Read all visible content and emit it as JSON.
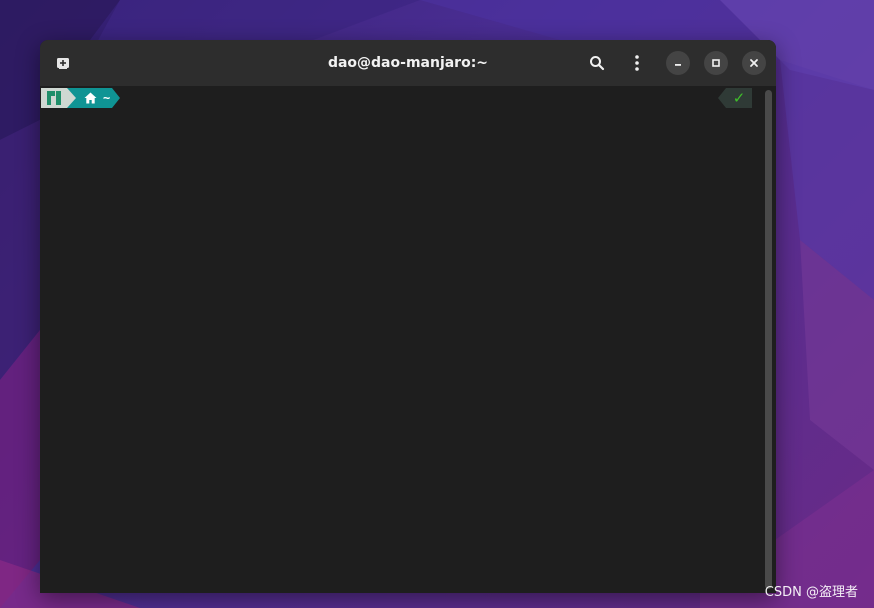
{
  "window": {
    "title": "dao@dao-manjaro:~"
  },
  "titlebar": {
    "icons": {
      "new_tab": "new-tab-icon",
      "search": "search-icon",
      "menu": "kebab-menu-icon",
      "minimize": "minimize-icon",
      "maximize": "maximize-icon",
      "close": "close-icon"
    }
  },
  "terminal": {
    "prompt": {
      "os_icon": "manjaro-logo-icon",
      "home_icon": "home-icon",
      "directory": "~",
      "status_symbol": "✓"
    }
  },
  "watermark": {
    "text": "CSDN @盗理者"
  },
  "colors": {
    "titlebar_bg": "#2d2d2d",
    "terminal_bg": "#1e1e1e",
    "prompt_os_bg": "#cfd8d2",
    "prompt_dir_bg": "#0f9494",
    "prompt_status_bg": "#2f3a36",
    "status_ok": "#3fbf2a",
    "desktop_accent": "#4b2e95"
  }
}
